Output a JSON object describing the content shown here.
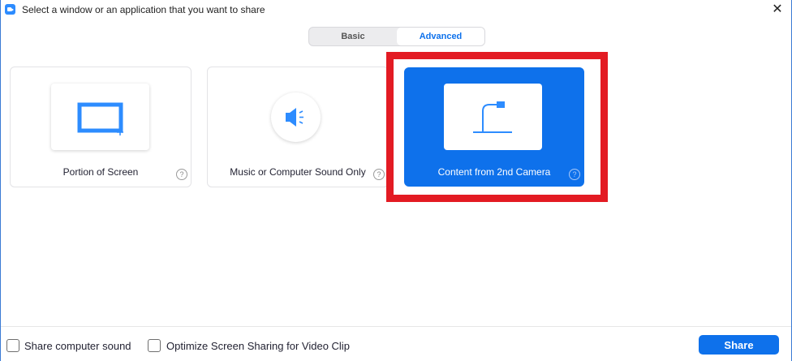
{
  "window": {
    "title": "Select a window or an application that you want to share",
    "close_glyph": "✕"
  },
  "tabs": [
    {
      "label": "Basic",
      "active": false
    },
    {
      "label": "Advanced",
      "active": true
    }
  ],
  "options": [
    {
      "label": "Portion of Screen",
      "icon": "portion-screen-icon",
      "help": "?",
      "selected": false
    },
    {
      "label": "Music or Computer Sound Only",
      "icon": "speaker-icon",
      "help": "?",
      "selected": false
    },
    {
      "label": "Content from 2nd Camera",
      "icon": "document-camera-icon",
      "help": "?",
      "selected": true
    }
  ],
  "footer": {
    "share_sound_label": "Share computer sound",
    "optimize_label": "Optimize Screen Sharing for Video Clip",
    "share_button": "Share"
  },
  "colors": {
    "accent": "#0e71eb",
    "highlight_box": "#e31b23",
    "icon_blue": "#2d8cff"
  }
}
